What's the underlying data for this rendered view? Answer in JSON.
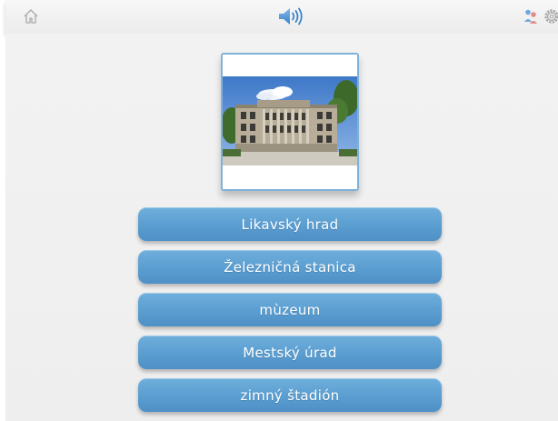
{
  "toolbar": {
    "home_icon": "home-icon",
    "speaker_icon": "speaker-icon",
    "people_icon": "people-icon",
    "settings_icon": "gear-icon"
  },
  "quiz": {
    "image_subject": "building-photo",
    "answers": [
      "Likavský hrad",
      "Železničná stanica",
      "mùzeum",
      "Mestský úrad",
      "zimný štadión"
    ]
  },
  "colors": {
    "accent": "#5a9dd0",
    "icon_blue": "#4a8fd0",
    "background": "#f0f0f0"
  }
}
